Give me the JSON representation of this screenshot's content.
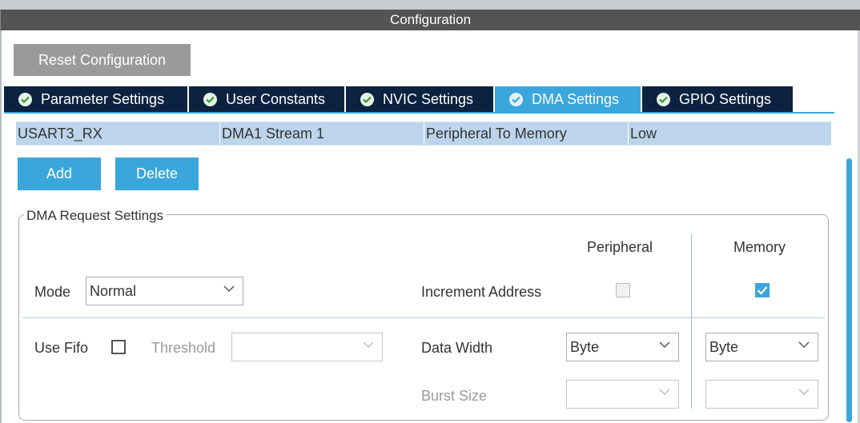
{
  "window": {
    "title": "Configuration"
  },
  "toolbar": {
    "reset_label": "Reset Configuration"
  },
  "tabs": [
    {
      "label": "Parameter Settings",
      "active": false
    },
    {
      "label": "User Constants",
      "active": false
    },
    {
      "label": "NVIC Settings",
      "active": false
    },
    {
      "label": "DMA Settings",
      "active": true
    },
    {
      "label": "GPIO Settings",
      "active": false
    }
  ],
  "dma_table": {
    "rows": [
      {
        "request": "USART3_RX",
        "stream": "DMA1 Stream 1",
        "direction": "Peripheral To Memory",
        "priority": "Low"
      }
    ]
  },
  "actions": {
    "add_label": "Add",
    "delete_label": "Delete"
  },
  "request_settings": {
    "legend": "DMA Request Settings",
    "peripheral_header": "Peripheral",
    "memory_header": "Memory",
    "mode_label": "Mode",
    "mode_value": "Normal",
    "increment_label": "Increment Address",
    "increment_peripheral": false,
    "increment_memory": true,
    "fifo_label": "Use Fifo",
    "fifo_checked": false,
    "threshold_label": "Threshold",
    "threshold_value": "",
    "data_width_label": "Data Width",
    "peripheral_data_width": "Byte",
    "memory_data_width": "Byte",
    "burst_label": "Burst Size",
    "peripheral_burst": "",
    "memory_burst": ""
  },
  "icons": {
    "tab_status": "check-circle-icon",
    "dropdown": "chevron-down-icon",
    "checkmark": "checkmark-icon"
  },
  "colors": {
    "accent": "#3aa6dc",
    "tab_bg": "#0b2240",
    "title_bg": "#545454",
    "reset_btn": "#9a9a9a",
    "row_selected": "#bcd5ec",
    "tab_check": "#2e9a3e"
  }
}
